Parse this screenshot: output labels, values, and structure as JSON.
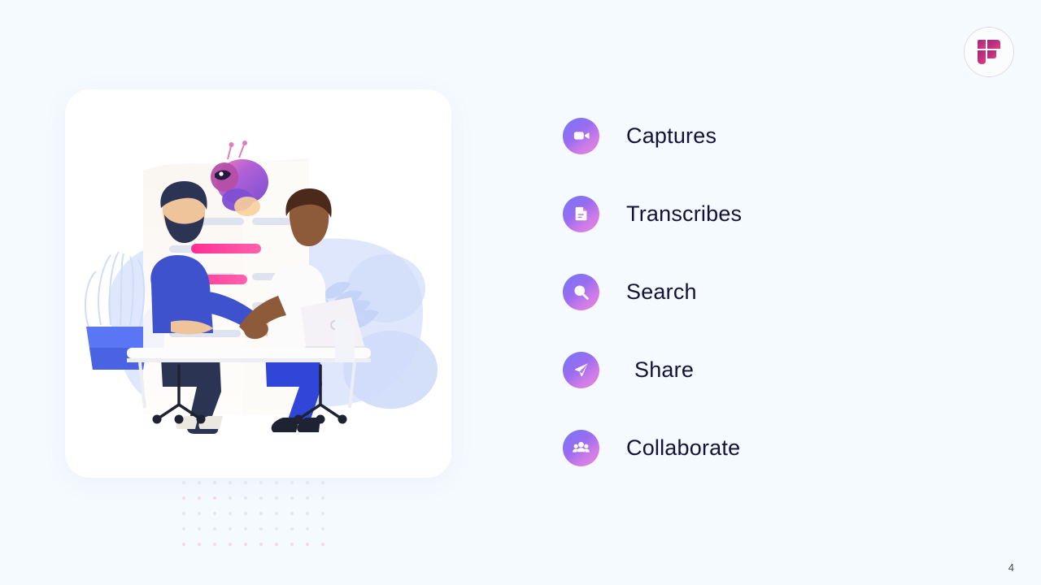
{
  "slide": {
    "background_color": "#f5faff",
    "page_number": "4"
  },
  "logo": {
    "name": "brand-logo-f",
    "alt_text": "F",
    "color_start": "#8e2a6e",
    "color_end": "#e0407f",
    "ring_color": "#e8d7e6"
  },
  "illustration": {
    "name": "meeting-transcription-illustration",
    "description": "Two people shaking hands across a desk with laptop, transcript document behind, AI robot, plant and leaf decorations",
    "card_background": "#ffffff",
    "accent_pink": "#ff2d93",
    "accent_blue": "#3f51e0",
    "backdrop_blue": "#d6e0fb"
  },
  "dot_grid": {
    "name": "decorative-dot-grid",
    "columns": 11,
    "rows": 5,
    "dot_color": "#e3e8f3",
    "dot_color_accent": "#f4dce6"
  },
  "features": {
    "items": [
      {
        "label": "Captures",
        "icon": "video-camera-icon"
      },
      {
        "label": "Transcribes",
        "icon": "document-icon"
      },
      {
        "label": "Search",
        "icon": "magnifier-icon"
      },
      {
        "label": "Share",
        "icon": "paper-plane-icon"
      },
      {
        "label": "Collaborate",
        "icon": "people-group-icon"
      }
    ],
    "icon_gradient_start": "#6f7bf7",
    "icon_gradient_end": "#e884d8",
    "label_color": "#14123a"
  }
}
